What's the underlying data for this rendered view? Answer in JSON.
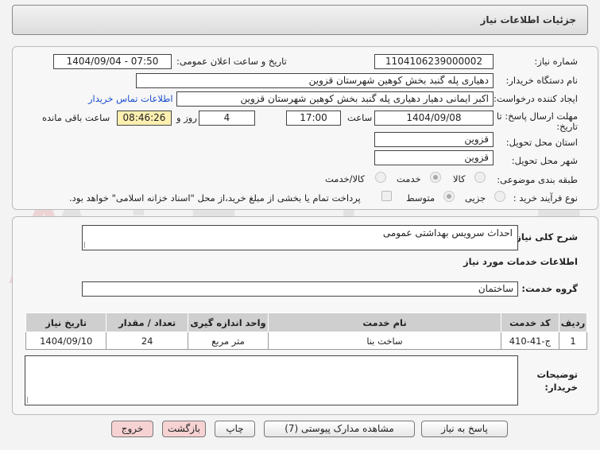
{
  "header": {
    "title": "جزئیات اطلاعات نیاز"
  },
  "form": {
    "need_number_label": "شماره نیاز:",
    "need_number": "1104106239000002",
    "announce_label": "تاریخ و ساعت اعلان عمومی:",
    "announce_value": "1404/09/04 - 07:50",
    "buyer_org_label": "نام دستگاه خریدار:",
    "buyer_org": "دهیاری پله گنبد بخش کوهین شهرستان قزوین",
    "creator_label": "ایجاد کننده درخواست:",
    "creator": "اکبر ایمانی دهیار دهیاری پله گنبد بخش کوهین شهرستان قزوین",
    "contact_link": "اطلاعات تماس خریدار",
    "deadline_label_1": "مهلت ارسال پاسخ: تا",
    "deadline_label_2": "تاریخ:",
    "deadline_date": "1404/09/08",
    "hour_label": "ساعت",
    "deadline_hour": "17:00",
    "days_value": "4",
    "days_label": "روز و",
    "remaining_time": "08:46:26",
    "remaining_label": "ساعت باقی مانده",
    "province_label": "استان محل تحویل:",
    "province": "قزوین",
    "city_label": "شهر محل تحویل:",
    "city": "قزوین",
    "category_label": "طبقه بندی موضوعی:",
    "category_options": [
      "کالا",
      "خدمت",
      "کالا/خدمت"
    ],
    "category_selected": "خدمت",
    "process_label": "نوع فرآیند خرید :",
    "process_options": [
      "جزیی",
      "متوسط"
    ],
    "process_selected": "متوسط",
    "payment_note": "پرداخت تمام یا بخشی از مبلغ خرید،از محل \"اسناد خزانه اسلامی\" خواهد بود."
  },
  "details": {
    "summary_label": "شرح کلی نیاز:",
    "summary": "احداث سرویس بهداشتی عمومی",
    "services_title": "اطلاعات خدمات مورد نیاز",
    "service_group_label": "گروه خدمت:",
    "service_group": "ساختمان"
  },
  "table": {
    "headers": [
      "ردیف",
      "کد خدمت",
      "نام خدمت",
      "واحد اندازه گیری",
      "تعداد / مقدار",
      "تاریخ نیاز"
    ],
    "rows": [
      [
        "1",
        "ج-41-410",
        "ساخت بنا",
        "متر مربع",
        "24",
        "1404/09/10"
      ]
    ]
  },
  "notes": {
    "label_1": "توضیحات",
    "label_2": "خریدار:",
    "value": ""
  },
  "buttons": {
    "reply": "پاسخ به نیاز",
    "attachments": "مشاهده مدارک پیوستی (7)",
    "print": "چاپ",
    "back": "بازگشت",
    "exit": "خروج"
  },
  "watermark": "AriaTender.neT",
  "colors": {
    "link": "#1a4ecc",
    "highlight": "#ffefb0",
    "pink_button": "#f7d2d2"
  }
}
